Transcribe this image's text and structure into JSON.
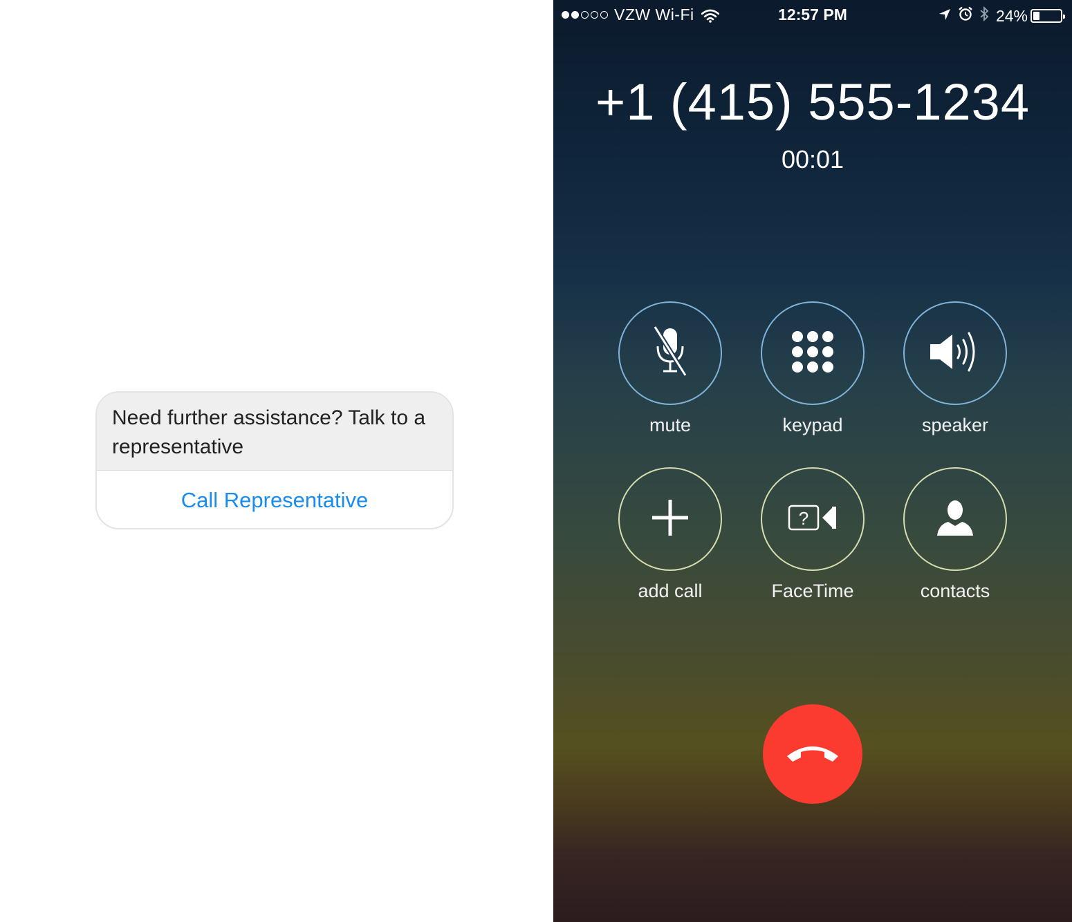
{
  "chat_card": {
    "message": "Need further assistance? Talk to a representative",
    "action_label": "Call Representative",
    "accent": "#1a8cf0"
  },
  "status_bar": {
    "signal_filled": 2,
    "signal_total": 5,
    "carrier": "VZW Wi-Fi",
    "time": "12:57 PM",
    "battery_percent": "24%",
    "battery_level": 0.24,
    "icons": [
      "wifi-icon",
      "location-arrow-icon",
      "alarm-icon",
      "bluetooth-icon",
      "battery-icon"
    ]
  },
  "call": {
    "number": "+1 (415) 555-1234",
    "duration": "00:01"
  },
  "controls": {
    "mute": {
      "label": "mute",
      "icon": "muted-microphone-icon"
    },
    "keypad": {
      "label": "keypad",
      "icon": "keypad-grid-icon"
    },
    "speaker": {
      "label": "speaker",
      "icon": "speaker-icon"
    },
    "add_call": {
      "label": "add call",
      "icon": "plus-icon"
    },
    "facetime": {
      "label": "FaceTime",
      "icon": "facetime-unavailable-icon"
    },
    "contacts": {
      "label": "contacts",
      "icon": "contact-person-icon"
    }
  },
  "end_call": {
    "icon": "end-call-handset-icon",
    "color": "#fb3b30"
  }
}
